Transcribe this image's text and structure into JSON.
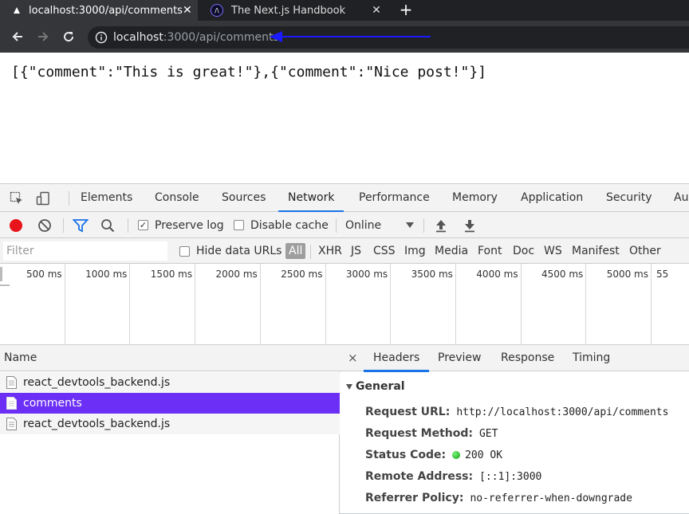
{
  "browser": {
    "tabs": [
      {
        "title": "localhost:3000/api/comments",
        "active": true
      },
      {
        "title": "The Next.js Handbook",
        "active": false
      }
    ],
    "url": {
      "host": "localhost",
      "rest": ":3000/api/comments"
    }
  },
  "page": {
    "body_text": "[{\"comment\":\"This is great!\"},{\"comment\":\"Nice post!\"}]"
  },
  "devtools": {
    "tabs": [
      "Elements",
      "Console",
      "Sources",
      "Network",
      "Performance",
      "Memory",
      "Application",
      "Security",
      "Au"
    ],
    "active_tab": "Network",
    "network_toolbar": {
      "preserve_log": {
        "label": "Preserve log",
        "checked": true
      },
      "disable_cache": {
        "label": "Disable cache",
        "checked": false
      },
      "throttling": "Online"
    },
    "filter": {
      "placeholder": "Filter",
      "hide_data_urls": {
        "label": "Hide data URLs",
        "checked": false
      },
      "types": [
        "All",
        "XHR",
        "JS",
        "CSS",
        "Img",
        "Media",
        "Font",
        "Doc",
        "WS",
        "Manifest",
        "Other"
      ]
    },
    "timeline": {
      "ticks": [
        "500 ms",
        "1000 ms",
        "1500 ms",
        "2000 ms",
        "2500 ms",
        "3000 ms",
        "3500 ms",
        "4000 ms",
        "4500 ms",
        "5000 ms",
        "55"
      ]
    },
    "requests": {
      "column": "Name",
      "rows": [
        {
          "name": "react_devtools_backend.js",
          "selected": false
        },
        {
          "name": "comments",
          "selected": true
        },
        {
          "name": "react_devtools_backend.js",
          "selected": false
        }
      ]
    },
    "details": {
      "close": "×",
      "tabs": [
        "Headers",
        "Preview",
        "Response",
        "Timing"
      ],
      "active_tab": "Headers",
      "section": "General",
      "headers": [
        {
          "key": "Request URL:",
          "value": "http://localhost:3000/api/comments"
        },
        {
          "key": "Request Method:",
          "value": "GET"
        },
        {
          "key": "Status Code:",
          "value": "200 OK"
        },
        {
          "key": "Remote Address:",
          "value": "[::1]:3000"
        },
        {
          "key": "Referrer Policy:",
          "value": "no-referrer-when-downgrade"
        }
      ]
    }
  },
  "colors": {
    "annotation_arrow": "#1a1aff",
    "selected_row": "#6b2ff5",
    "record": "#e8141b",
    "status_ok": "#0ca30c",
    "active_tab_underline": "#1a73e8"
  }
}
